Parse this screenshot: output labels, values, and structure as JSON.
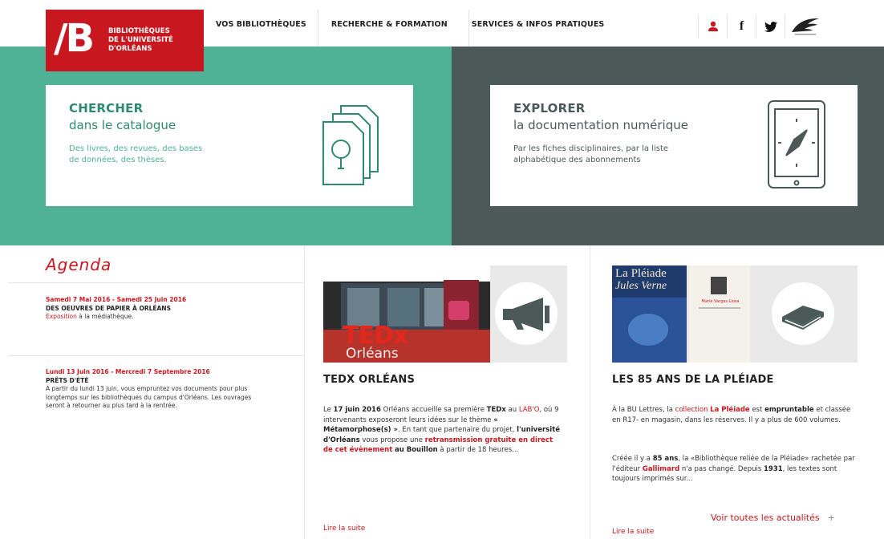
{
  "header": {
    "logo_mark": "/B",
    "logo_lines": [
      "Bibliothèques",
      "de l'Université",
      "d'Orléans"
    ],
    "nav": [
      "VOS BIBLIOTHÈQUES",
      "RECHERCHE & FORMATION",
      "SERVICES & INFOS PRATIQUES"
    ],
    "icons": [
      "user-icon",
      "facebook-icon",
      "twitter-icon",
      "university-logo-icon"
    ]
  },
  "hero": {
    "left_color": "#4fb196",
    "right_color": "#4b5a58",
    "chercher": {
      "title": "CHERCHER",
      "subtitle": "dans le catalogue",
      "description": "Des livres, des revues, des bases de données, des thèses."
    },
    "explorer": {
      "title": "EXPLORER",
      "subtitle": "la documentation numérique",
      "description": "Par les fiches disciplinaires, par la liste alphabétique des abonnements"
    }
  },
  "agenda": {
    "title": "Agenda",
    "events": [
      {
        "date": "Samedi 7 Mai 2016 - Samedi 25 Juin 2016",
        "title": "DES OEUVRES DE PAPIER À ORLÉANS",
        "type_link": "Exposition",
        "type_rest": " à la médiathèque."
      },
      {
        "date": "Lundi 13 Juin 2016 - Mercredi 7 Septembre 2016",
        "title": "PRÊTS D'ÉTÉ",
        "description": "A partir du lundi 13 juin, vous empruntez vos documents pour plus longtemps sur les bibliothèques du campus d'Orléans. Les ouvrages seront à retourner au plus tard à la rentrée."
      }
    ]
  },
  "news": [
    {
      "title": "TEDX ORLÉANS",
      "image_text": "TEDx",
      "image_sub": "Orléans",
      "p_1": "Le ",
      "p_2": "17 juin 2016",
      "p_3": " Orléans accueille sa première ",
      "p_4": "TEDx",
      "p_5": " au ",
      "p_6": "LAB'O",
      "p_7": ", où 9 intervenants exposeront leurs idées sur le thème ",
      "p_8": "« Métamorphose(s) »",
      "p_9": ". En tant que partenaire du projet, ",
      "p_10": "l'université d'Orléans",
      "p_11": " vous propose une ",
      "p_12": "retransmission gratuite en direct de cet évènement",
      "p_13": " ",
      "p_14": "au Bouillon",
      "p_15": " à partir de 18 heures...",
      "read_more": "Lire la suite"
    },
    {
      "title": "LES 85 ANS DE LA PLÉIADE",
      "book1_l1": "La Pléiade",
      "book1_l2": "Jules Verne",
      "book2": "Marie Vargas Llosa",
      "a1": "À la BU Lettres, la ",
      "a2": "collection",
      "a3": " ",
      "a4": "La Pléiade",
      "a5": " est ",
      "a6": "empruntable",
      "a7": " et classée en R17- en magasin, dans les réserves. Il y a plus de 600 volumes.",
      "b1": "Créée il y a ",
      "b2": "85 ans",
      "b3": ", la «Bibliothèque reliée de la Pléiade» rachetée par l'éditeur ",
      "b4": "Gallimard",
      "b5": " n'a pas changé. Depuis ",
      "b6": "1931",
      "b7": ", les textes sont toujours imprimés sur...",
      "read_more": "Lire la suite"
    }
  ],
  "all_news": "Voir toutes les actualités",
  "all_news_plus": "+"
}
